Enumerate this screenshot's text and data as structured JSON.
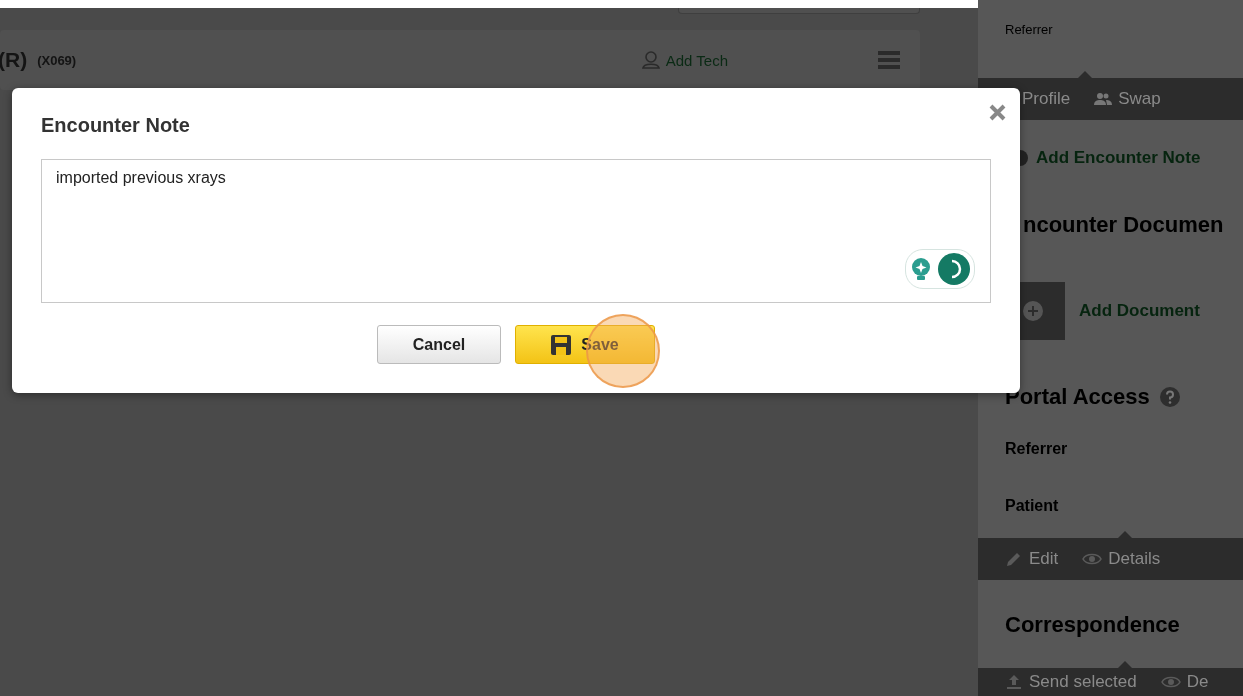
{
  "background_card": {
    "title": "(R)",
    "code": "(X069)",
    "add_tech": "Add Tech"
  },
  "sidebar": {
    "referrer_label": "Referrer",
    "profile_actions": [
      {
        "kind": "profile",
        "label": "Profile"
      },
      {
        "kind": "swap",
        "label": "Swap"
      }
    ],
    "add_note": "Add Encounter Note",
    "documents_heading": "ncounter Documen",
    "add_document": "Add Document",
    "portal_access": {
      "heading": "Portal Access",
      "rows": [
        "Referrer",
        "Patient"
      ],
      "actions": [
        {
          "kind": "edit",
          "label": "Edit"
        },
        {
          "kind": "details",
          "label": "Details"
        }
      ]
    },
    "correspondence": {
      "heading": "Correspondence",
      "actions": [
        {
          "kind": "send",
          "label": "Send selected"
        },
        {
          "kind": "details",
          "label": "De"
        }
      ]
    }
  },
  "dialog": {
    "title": "Encounter Note",
    "note": "imported previous xrays",
    "buttons": [
      {
        "kind": "secondary",
        "label": "Cancel"
      },
      {
        "kind": "primary",
        "label": "Save"
      }
    ]
  }
}
